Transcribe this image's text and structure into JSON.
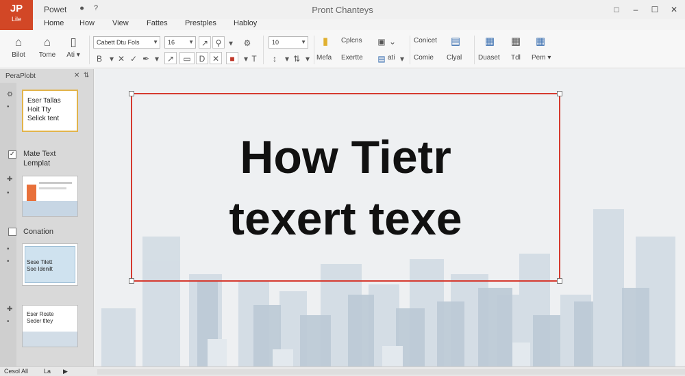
{
  "app": {
    "logo_line1": "JP",
    "logo_line2": "Lile",
    "name": "Powet",
    "qa_help": "?",
    "doc_title": "Pront Chanteys",
    "win_minimize": "–",
    "win_maximize": "☐",
    "win_close": "✕"
  },
  "tabs": [
    "Home",
    "How",
    "View",
    "Fattes",
    "Prestples",
    "Habloy"
  ],
  "ribbon": {
    "btn1": "Bilot",
    "btn2": "Tome",
    "btn3": "Ati",
    "font_name": "Cabett Dtu Fols",
    "font_size": "16",
    "size2": "10",
    "btn_mefa": "Mefa",
    "btn_cplcns": "Cplcns",
    "btn_exertte": "Exertte",
    "btn_ati2": "ati",
    "btn_conicet": "Conicet",
    "btn_comie": "Comie",
    "btn_clyal": "Clyal",
    "btn_duaset": "Duaset",
    "btn_tdl": "Tdl",
    "btn_pem": "Pem"
  },
  "pane": {
    "title": "PeraPlobt",
    "slide1_text": "Eser Tallas\nHoit Tty\nSelick tent",
    "label_make": "Mate Text\nLemplat",
    "label_conation": "Conation",
    "slide3_text": "Sese Tilett\nSoe Idenilt",
    "slide4_text": "Eser Roste\nSeder tltey"
  },
  "slide": {
    "line1": "How Tietr",
    "line2": "texert texe"
  },
  "status": {
    "left": "Cesol All",
    "page": "La"
  },
  "colors": {
    "accent": "#d24726",
    "selection_border": "#d53a2f",
    "thumb_selected": "#e2b44a"
  }
}
